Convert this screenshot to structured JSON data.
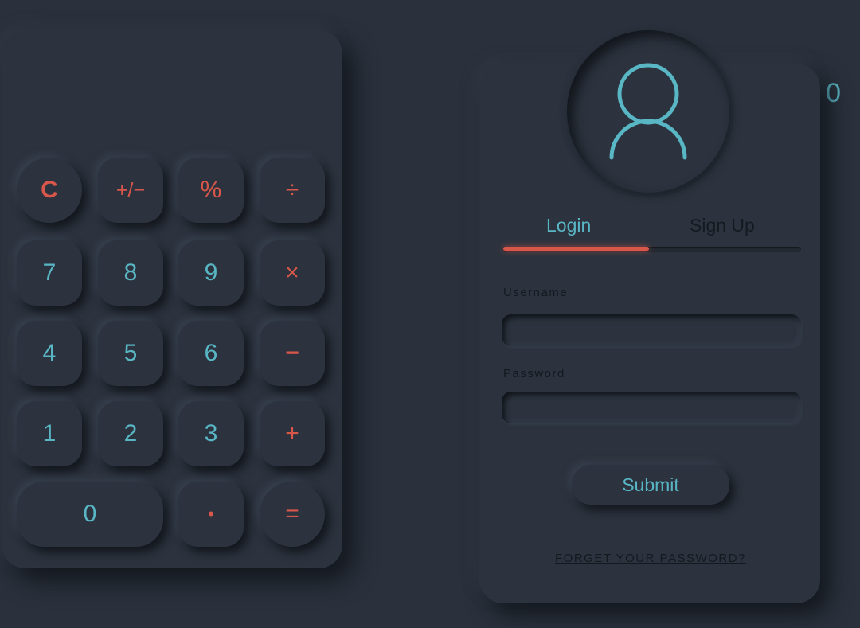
{
  "calculator": {
    "display": "0",
    "keys": [
      {
        "label": "C",
        "color": "red"
      },
      {
        "label": "+/−",
        "color": "red"
      },
      {
        "label": "%",
        "color": "red"
      },
      {
        "label": "÷",
        "color": "red"
      },
      {
        "label": "7",
        "color": "blue"
      },
      {
        "label": "8",
        "color": "blue"
      },
      {
        "label": "9",
        "color": "blue"
      },
      {
        "label": "×",
        "color": "red"
      },
      {
        "label": "4",
        "color": "blue"
      },
      {
        "label": "5",
        "color": "blue"
      },
      {
        "label": "6",
        "color": "blue"
      },
      {
        "label": "−",
        "color": "red"
      },
      {
        "label": "1",
        "color": "blue"
      },
      {
        "label": "2",
        "color": "blue"
      },
      {
        "label": "3",
        "color": "blue"
      },
      {
        "label": "+",
        "color": "red"
      },
      {
        "label": "0",
        "color": "blue"
      },
      {
        "label": "•",
        "color": "red"
      },
      {
        "label": "=",
        "color": "red"
      }
    ]
  },
  "login": {
    "tabs": {
      "login": "Login",
      "signup": "Sign Up"
    },
    "username_label": "Username",
    "password_label": "Password",
    "submit_label": "Submit",
    "forgot_label": "FORGET YOUR PASSWORD?",
    "avatar_icon": "user-icon"
  },
  "colors": {
    "background": "#2a313c",
    "accent": "#59b6c4",
    "operator": "#d9564a"
  }
}
